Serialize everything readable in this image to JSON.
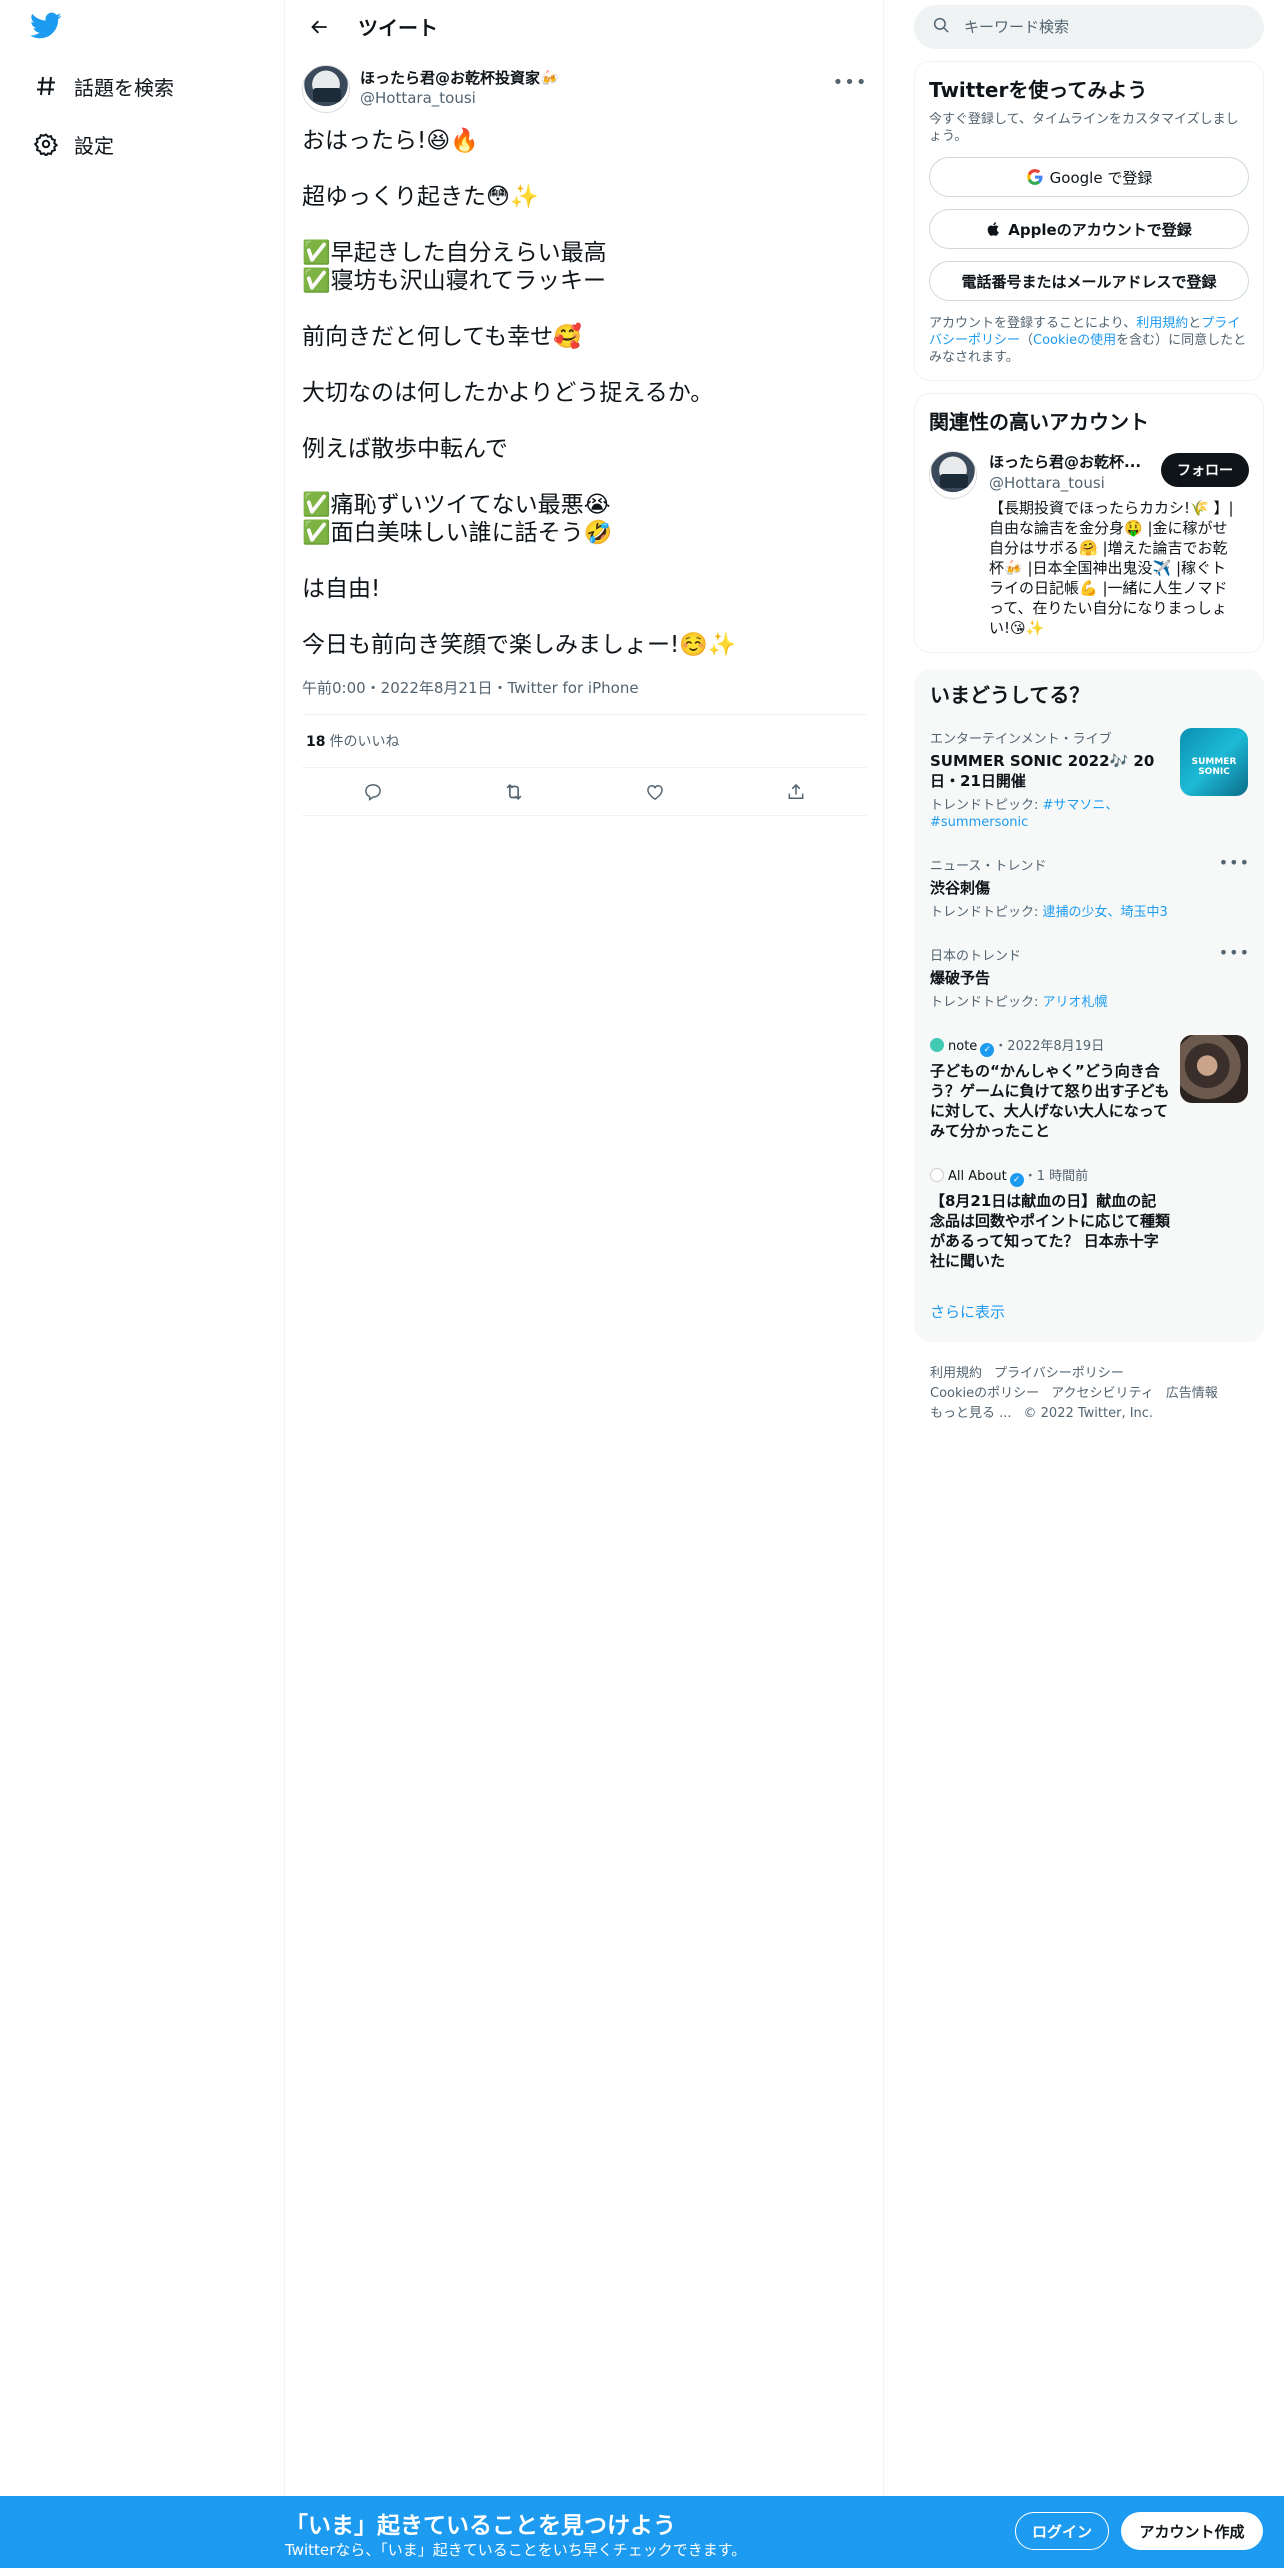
{
  "nav": {
    "items": [
      {
        "label": "話題を検索",
        "icon": "hashtag-icon"
      },
      {
        "label": "設定",
        "icon": "gear-icon"
      }
    ]
  },
  "header": {
    "title": "ツイート"
  },
  "tweet": {
    "display_name": "ほったら君@お乾杯投資家🍻",
    "handle": "@Hottara_tousi",
    "paragraphs": [
      "おはったら!😆🔥",
      "超ゆっくり起きた😳✨",
      "✅早起きした自分えらい最高\n✅寝坊も沢山寝れてラッキー",
      "前向きだと何しても幸せ🥰",
      "大切なのは何したかよりどう捉えるか。",
      "例えば散歩中転んで",
      "✅痛恥ずいツイてない最悪😭\n✅面白美味しい誰に話そう🤣",
      "は自由!",
      "今日も前向き笑顔で楽しみましょー!☺️✨"
    ],
    "meta": "午前0:00・2022年8月21日・Twitter for iPhone",
    "likes_count": "18",
    "likes_label": "件のいいね"
  },
  "search": {
    "placeholder": "キーワード検索"
  },
  "signup_card": {
    "title": "Twitterを使ってみよう",
    "subtitle": "今すぐ登録して、タイムラインをカスタマイズしましょう。",
    "google_label": "Google で登録",
    "apple_label": "Appleのアカウントで登録",
    "phone_label": "電話番号またはメールアドレスで登録",
    "legal_prefix": "アカウントを登録することにより、",
    "legal_terms": "利用規約",
    "legal_and": "と",
    "legal_privacy": "プライバシーポリシー",
    "legal_open": "（",
    "legal_cookie": "Cookieの使用",
    "legal_suffix": "を含む）に同意したとみなされます。"
  },
  "related": {
    "title": "関連性の高いアカウント",
    "name": "ほったら君@お乾杯...",
    "handle": "@Hottara_tousi",
    "follow_label": "フォロー",
    "bio": "【長期投資でほったらカカシ!🌾 】|自由な論吉を金分身🤑 |金に稼がせ自分はサボる🤗 |増えた論吉でお乾杯🍻 |日本全国神出鬼没✈️ |稼ぐトライの日記帳💪 |一緒に人生ノマドって、在りたい自分になりまっしょい!😘✨"
  },
  "trends": {
    "title": "いまどうしてる？",
    "items": [
      {
        "context": "エンターテインメント・ライブ",
        "name": "SUMMER SONIC 2022🎶 20日・21日開催",
        "topic_prefix": "トレンドトピック: ",
        "topic_links": "#サマソニ、#summersonic"
      },
      {
        "context": "ニュース・トレンド",
        "name": "渋谷刺傷",
        "topic_prefix": "トレンドトピック: ",
        "topic_links": "逮捕の少女、埼玉中3"
      },
      {
        "context": "日本のトレンド",
        "name": "爆破予告",
        "topic_prefix": "トレンドトピック: ",
        "topic_links": "アリオ札幌"
      },
      {
        "source": "note",
        "time": "・2022年8月19日",
        "name": "子どもの“かんしゃく”どう向き合う？ゲームに負けて怒り出す子どもに対して、大人げない大人になってみて分かったこと"
      },
      {
        "source": "All About",
        "time": "・1 時間前",
        "name": "【8月21日は献血の日】献血の記念品は回数やポイントに応じて種類があるって知ってた？ 日本赤十字社に聞いた"
      }
    ],
    "show_more": "さらに表示"
  },
  "footer": {
    "links": [
      "利用規約",
      "プライバシーポリシー",
      "Cookieのポリシー",
      "アクセシビリティ",
      "広告情報",
      "もっと見る ..."
    ],
    "copyright": "© 2022 Twitter, Inc."
  },
  "bottom_bar": {
    "title": "「いま」起きていることを見つけよう",
    "subtitle": "Twitterなら、「いま」起きていることをいち早くチェックできます。",
    "login_label": "ログイン",
    "signup_label": "アカウント作成"
  },
  "colors": {
    "accent": "#1d9bf0",
    "text": "#0f1419",
    "secondary": "#536471"
  }
}
